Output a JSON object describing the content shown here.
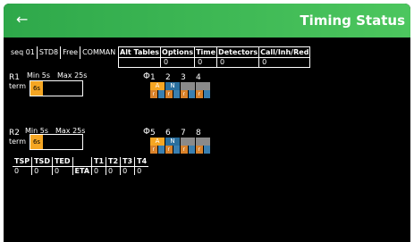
{
  "header": {
    "back_icon": "←",
    "title": "Timing Status"
  },
  "tabs": [
    "seq 01",
    "STD8",
    "Free",
    "COMMAN"
  ],
  "menu": [
    {
      "label": "Alt Tables",
      "value": ""
    },
    {
      "label": "Options",
      "value": "0"
    },
    {
      "label": "Time",
      "value": "0"
    },
    {
      "label": "Detectors",
      "value": "0"
    },
    {
      "label": "Call/Inh/Red",
      "value": "0"
    }
  ],
  "rings": [
    {
      "name": "R1",
      "min": "Min 5s",
      "max": "Max 25s",
      "term": "term",
      "timer": "6s",
      "phi": "Φ",
      "phases": [
        "1",
        "2",
        "3",
        "4"
      ],
      "bars": [
        {
          "label": "A",
          "color": "#f5a623"
        },
        {
          "label": "N",
          "color": "#2a6f9e"
        },
        {
          "label": "",
          "color": "#8a8a8a"
        },
        {
          "label": "",
          "color": "#8a8a8a"
        }
      ],
      "subs": [
        {
          "label": "r",
          "color": "#d9822b"
        },
        {
          "label": "",
          "color": "#3a7fb0"
        },
        {
          "label": "r",
          "color": "#d9822b"
        },
        {
          "label": "",
          "color": "#3a7fb0"
        },
        {
          "label": "r",
          "color": "#d9822b"
        },
        {
          "label": "",
          "color": "#3a7fb0"
        },
        {
          "label": "r",
          "color": "#d9822b"
        },
        {
          "label": "",
          "color": "#3a7fb0"
        }
      ]
    },
    {
      "name": "R2",
      "min": "Min 5s",
      "max": "Max 25s",
      "term": "term",
      "timer": "6s",
      "phi": "Φ",
      "phases": [
        "5",
        "6",
        "7",
        "8"
      ],
      "bars": [
        {
          "label": "A",
          "color": "#f5a623"
        },
        {
          "label": "N",
          "color": "#2a6f9e"
        },
        {
          "label": "",
          "color": "#8a8a8a"
        },
        {
          "label": "",
          "color": "#8a8a8a"
        }
      ],
      "subs": [
        {
          "label": "r",
          "color": "#d9822b"
        },
        {
          "label": "",
          "color": "#3a7fb0"
        },
        {
          "label": "r",
          "color": "#d9822b"
        },
        {
          "label": "",
          "color": "#3a7fb0"
        },
        {
          "label": "r",
          "color": "#d9822b"
        },
        {
          "label": "",
          "color": "#3a7fb0"
        },
        {
          "label": "r",
          "color": "#d9822b"
        },
        {
          "label": "",
          "color": "#3a7fb0"
        }
      ]
    }
  ],
  "tsp": {
    "headers": [
      "TSP",
      "TSD",
      "TED",
      "",
      "T1",
      "T2",
      "T3",
      "T4"
    ],
    "values": [
      "0",
      "0",
      "0",
      "ETA",
      "0",
      "0",
      "0",
      "0"
    ]
  }
}
